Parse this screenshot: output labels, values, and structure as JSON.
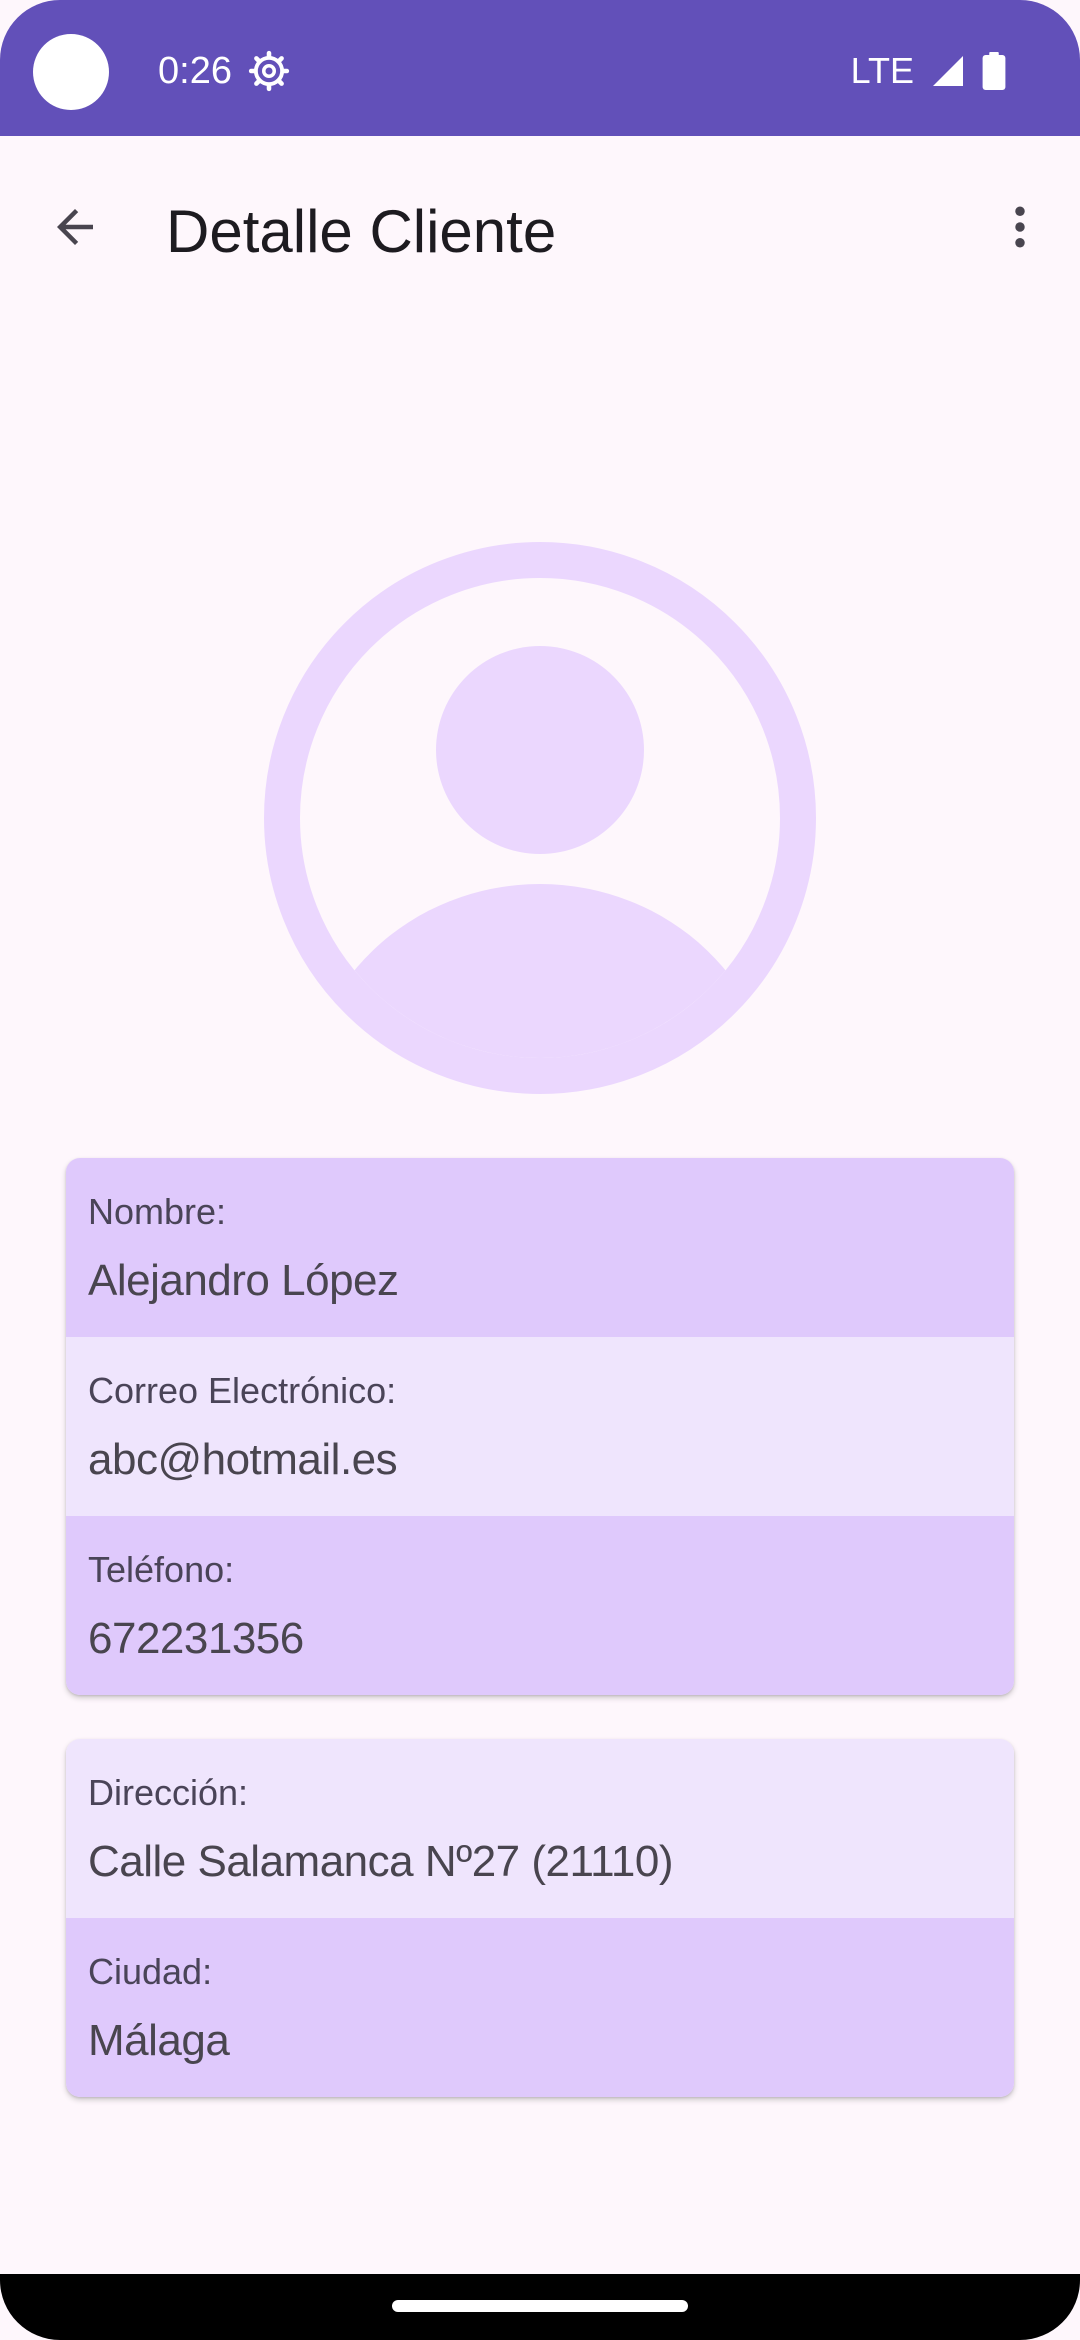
{
  "status_bar": {
    "time": "0:26",
    "network": "LTE",
    "icons": [
      "camera-dot",
      "gear-icon",
      "signal-icon",
      "battery-icon"
    ]
  },
  "app_bar": {
    "title": "Detalle Cliente",
    "icons": [
      "back-arrow-icon",
      "more-vert-icon"
    ]
  },
  "avatar": {
    "icon": "account-circle-icon",
    "color": "#ebd7fe"
  },
  "client_info": [
    {
      "label": "Nombre:",
      "value": "Alejandro López"
    },
    {
      "label": "Correo Electrónico:",
      "value": "abc@hotmail.es"
    },
    {
      "label": "Teléfono:",
      "value": "672231356"
    }
  ],
  "address_info": [
    {
      "label": "Dirección:",
      "value": "Calle Salamanca Nº27 (21110)"
    },
    {
      "label": "Ciudad:",
      "value": "Málaga"
    }
  ],
  "colors": {
    "status_bar": "#6250b9",
    "background": "#fef7fc",
    "row_dark": "#dfc9fc",
    "row_light": "#efe5fd"
  }
}
